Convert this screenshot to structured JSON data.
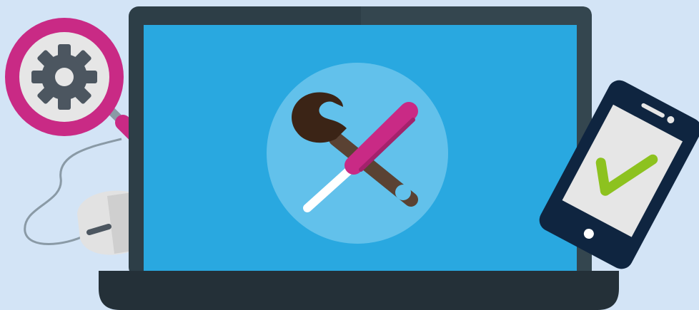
{
  "scene": {
    "description_free": true,
    "colors": {
      "background": "#d3e4f6",
      "laptop_frame": "#2d3e47",
      "laptop_frame_shade": "#34464f",
      "screen": "#29a8e0",
      "screen_circle": "#62c1eb",
      "wrench": "#3b2416",
      "wrench_handle": "#5a4233",
      "screwdriver_handle": "#c92a85",
      "screwdriver_shaft": "#ffffff",
      "magnifier_ring": "#c92a85",
      "magnifier_lens": "#e6e6e6",
      "gear": "#4c5660",
      "mouse_body": "#e2e2e2",
      "mouse_button": "#4c5660",
      "phone_body": "#0f2540",
      "phone_screen": "#e6e6e6",
      "checkmark": "#8dc21f",
      "base": "#243038"
    },
    "icons": [
      "magnifier-gear-icon",
      "laptop-icon",
      "wrench-icon",
      "screwdriver-icon",
      "computer-mouse-icon",
      "smartphone-icon",
      "checkmark-icon"
    ]
  }
}
